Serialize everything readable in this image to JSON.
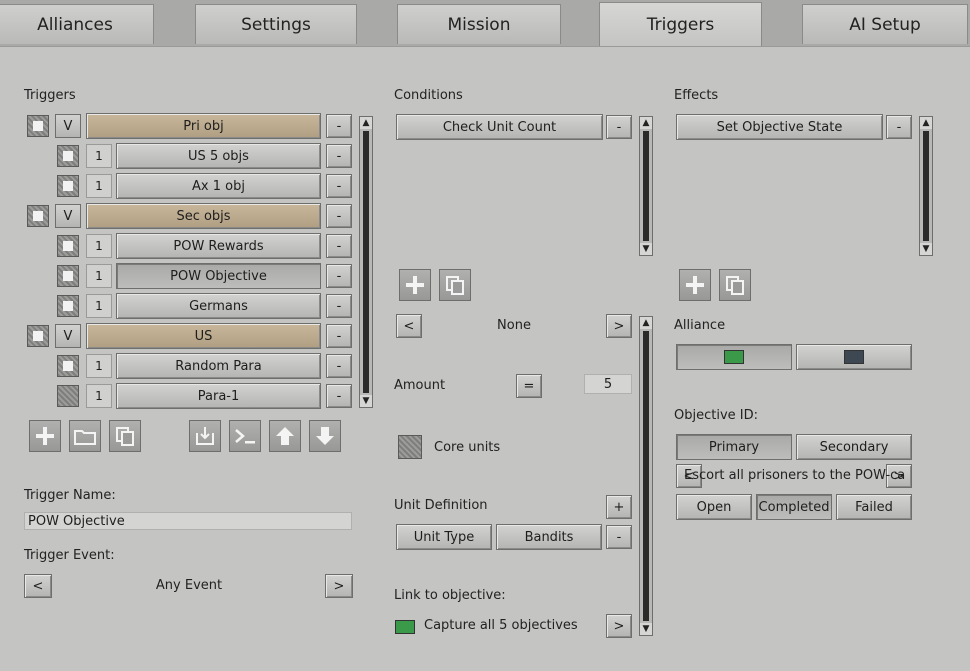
{
  "tabs": [
    {
      "label": "Alliances",
      "active": false
    },
    {
      "label": "Settings",
      "active": false
    },
    {
      "label": "Mission",
      "active": false
    },
    {
      "label": "Triggers",
      "active": true
    },
    {
      "label": "AI Setup",
      "active": false
    }
  ],
  "triggers": {
    "heading": "Triggers",
    "items": [
      {
        "label": "Pri obj",
        "level": "group",
        "badge": "V",
        "checked": true
      },
      {
        "label": "US 5 objs",
        "level": "child",
        "badge": "1",
        "checked": true
      },
      {
        "label": "Ax 1 obj",
        "level": "child",
        "badge": "1",
        "checked": true
      },
      {
        "label": "Sec objs",
        "level": "group",
        "badge": "V",
        "checked": true
      },
      {
        "label": "POW Rewards",
        "level": "child",
        "badge": "1",
        "checked": true
      },
      {
        "label": "POW Objective",
        "level": "child",
        "badge": "1",
        "checked": true,
        "selected": true
      },
      {
        "label": "Germans",
        "level": "child",
        "badge": "1",
        "checked": true
      },
      {
        "label": "US",
        "level": "group",
        "badge": "V",
        "checked": true
      },
      {
        "label": "Random Para",
        "level": "child",
        "badge": "1",
        "checked": true
      },
      {
        "label": "Para-1",
        "level": "child",
        "badge": "1",
        "checked": false
      }
    ],
    "remove_label": "-",
    "name_label": "Trigger Name:",
    "name_value": "POW Objective",
    "event_label": "Trigger Event:",
    "event_value": "Any Event",
    "prev_label": "<",
    "next_label": ">"
  },
  "conditions": {
    "heading": "Conditions",
    "items": [
      "Check Unit Count"
    ],
    "remove_label": "-",
    "selector_value": "None",
    "prev_label": "<",
    "next_label": ">",
    "amount_label": "Amount",
    "amount_operator": "=",
    "amount_value": "5",
    "core_units_label": "Core units",
    "unit_def_label": "Unit Definition",
    "unit_def_add": "+",
    "unit_def_remove": "-",
    "unit_type_label": "Unit Type",
    "unit_type_value": "Bandits",
    "link_label": "Link to objective:",
    "link_value": "Capture all 5 objectives",
    "link_next": ">"
  },
  "effects": {
    "heading": "Effects",
    "items": [
      "Set Objective State"
    ],
    "remove_label": "-",
    "alliance_label": "Alliance",
    "alliance_colors": [
      "#3a9a4a",
      "#3e4852"
    ],
    "objective_id_label": "Objective ID:",
    "objective_types": [
      "Primary",
      "Secondary"
    ],
    "objective_text": "Escort all prisoners to the POW-camp",
    "obj_prev": "<",
    "obj_next": ">",
    "states": [
      "Open",
      "Completed",
      "Failed"
    ],
    "selected_state": "Completed"
  },
  "colors": {
    "link_swatch": "#3a9a4a"
  }
}
